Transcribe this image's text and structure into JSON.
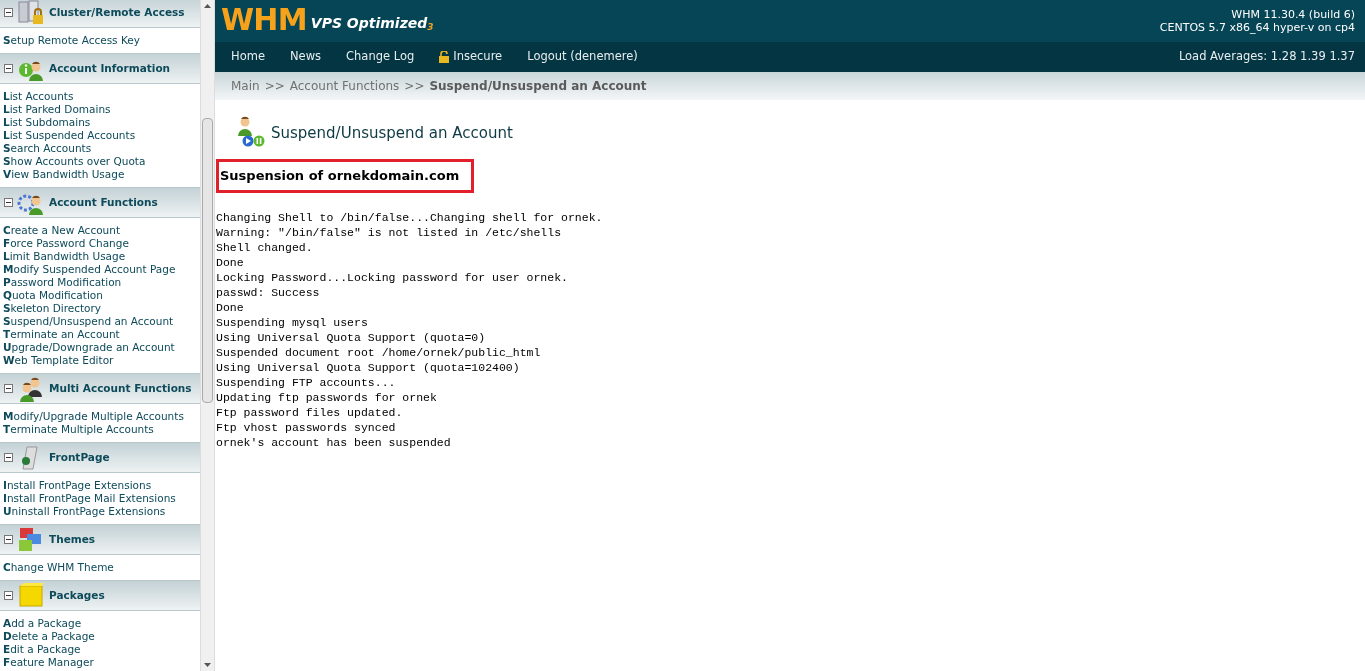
{
  "sidebar": {
    "sections": [
      {
        "title": "Cluster/Remote Access",
        "expanded": true,
        "items": [
          "**S**etup Remote Access Key"
        ]
      },
      {
        "title": "Account Information",
        "expanded": true,
        "items": [
          "**L**ist Accounts",
          "**L**ist Parked Domains",
          "**L**ist Subdomains",
          "**L**ist Suspended Accounts",
          "**S**earch Accounts",
          "**S**how Accounts over Quota",
          "**V**iew Bandwidth Usage"
        ]
      },
      {
        "title": "Account Functions",
        "expanded": true,
        "items": [
          "**C**reate a New Account",
          "**F**orce Password Change",
          "**L**imit Bandwidth Usage",
          "**M**odify Suspended Account Page",
          "**P**assword Modification",
          "**Q**uota Modification",
          "**S**keleton Directory",
          "**S**uspend/Unsuspend an Account",
          "**T**erminate an Account",
          "**U**pgrade/Downgrade an Account",
          "**W**eb Template Editor"
        ]
      },
      {
        "title": "Multi Account Functions",
        "expanded": true,
        "items": [
          "**M**odify/Upgrade Multiple Accounts",
          "**T**erminate Multiple Accounts"
        ]
      },
      {
        "title": "FrontPage",
        "expanded": true,
        "items": [
          "**I**nstall FrontPage Extensions",
          "**I**nstall FrontPage Mail Extensions",
          "**U**ninstall FrontPage Extensions"
        ]
      },
      {
        "title": "Themes",
        "expanded": true,
        "items": [
          "**C**hange WHM Theme"
        ]
      },
      {
        "title": "Packages",
        "expanded": true,
        "items": [
          "**A**dd a Package",
          "**D**elete a Package",
          "**E**dit a Package",
          "**F**eature Manager"
        ]
      }
    ]
  },
  "header": {
    "logo": "WHM",
    "logo_sub": "VPS Optimized",
    "logo_sup": "3",
    "version": "WHM 11.30.4 (build 6)",
    "server": "CENTOS 5.7 x86_64 hyper-v on cp4"
  },
  "nav": {
    "items": [
      {
        "label": "Home",
        "kind": "link"
      },
      {
        "label": "News",
        "kind": "link"
      },
      {
        "label": "Change Log",
        "kind": "link"
      },
      {
        "label": "Insecure",
        "kind": "lock"
      },
      {
        "label": "Logout (denemere)",
        "kind": "link"
      }
    ],
    "load": "Load Averages: 1.28 1.39 1.37"
  },
  "breadcrumb": [
    {
      "label": "Main",
      "current": false
    },
    {
      "label": "Account Functions",
      "current": false
    },
    {
      "label": "Suspend/Unsuspend an Account",
      "current": true
    }
  ],
  "breadcrumb_separator": ">>",
  "page": {
    "title": "Suspend/Unsuspend an Account",
    "heading": "Suspension of ornekdomain.com",
    "highlighted": true,
    "log": [
      "Changing Shell to /bin/false...Changing shell for ornek.",
      "Warning: \"/bin/false\" is not listed in /etc/shells",
      "Shell changed.",
      "Done",
      "Locking Password...Locking password for user ornek.",
      "passwd: Success",
      "Done",
      "Suspending mysql users",
      "Using Universal Quota Support (quota=0)",
      "Suspended document root /home/ornek/public_html",
      "Using Universal Quota Support (quota=102400)",
      "Suspending FTP accounts...",
      "Updating ftp passwords for ornek",
      "Ftp password files updated.",
      "Ftp vhost passwords synced",
      "ornek's account has been suspended"
    ]
  }
}
